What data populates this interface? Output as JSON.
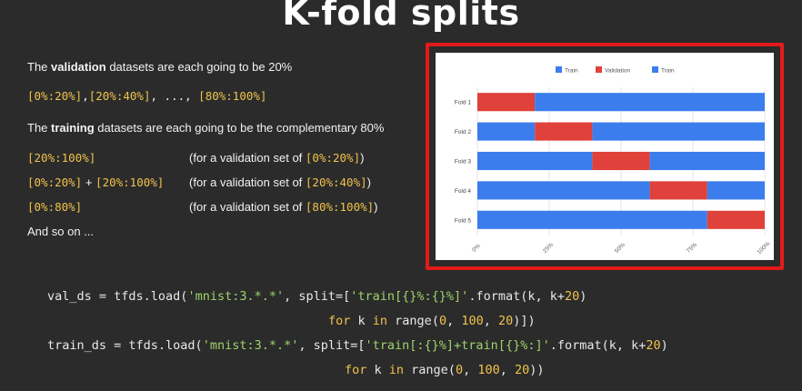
{
  "title": "K-fold splits",
  "text": {
    "val_intro_pre": "The ",
    "val_intro_bold": "validation",
    "val_intro_post": " datasets are each going to be 20%",
    "val_ranges": {
      "r1": "[0%:20%]",
      "r2": "[20%:40%]",
      "ellipsis": ", ..., ",
      "r3": "[80%:100%]",
      "sep": ","
    },
    "train_intro_pre": "The ",
    "train_intro_bold": "training",
    "train_intro_post": " datasets are each going to be the complementary 80%",
    "rows": [
      {
        "left": "[20%:100%]",
        "note_pre": "(for a validation set of ",
        "note_val": "[0%:20%]",
        "note_post": ")"
      },
      {
        "left_a": "[0%:20%]",
        "plus": " + ",
        "left_b": "[20%:100%]",
        "note_pre": "(for a validation set of ",
        "note_val": "[20%:40%]",
        "note_post": ")"
      },
      {
        "left": "[0%:80%]",
        "note_pre": "(for a validation set of ",
        "note_val": "[80%:100%]",
        "note_post": ")"
      }
    ],
    "and_so_on": "And so on ..."
  },
  "chart_data": {
    "type": "bar",
    "orientation": "horizontal",
    "stacked": true,
    "categories": [
      "Fold 1",
      "Fold 2",
      "Fold 3",
      "Fold 4",
      "Fold 5"
    ],
    "series": [
      {
        "name": "Train",
        "values": [
          0,
          20,
          40,
          60,
          80
        ]
      },
      {
        "name": "Validation",
        "values": [
          20,
          20,
          20,
          20,
          20
        ]
      },
      {
        "name": "Train",
        "values": [
          80,
          60,
          40,
          20,
          0
        ]
      }
    ],
    "xlim": [
      0,
      100
    ],
    "xticks": [
      "0%",
      "25%",
      "50%",
      "75%",
      "100%"
    ],
    "legend": "top",
    "colors": {
      "train": "#3b7ded",
      "validation": "#e0413a"
    },
    "grid": true
  },
  "code": {
    "l1_a": "val_ds = tfds.load(",
    "l1_s1": "'mnist:3.*.*'",
    "l1_b": ", split=[",
    "l1_s2": "'train[{}%:{}%]'",
    "l1_c": ".format(k, k+",
    "l1_n": "20",
    "l1_d": ")",
    "l2_kw1": "for",
    "l2_a": " k ",
    "l2_kw2": "in",
    "l2_b": " range(",
    "l2_n1": "0",
    "l2_c": ", ",
    "l2_n2": "100",
    "l2_d": ", ",
    "l2_n3": "20",
    "l2_e": ")])",
    "l3_a": "train_ds = tfds.load(",
    "l3_s1": "'mnist:3.*.*'",
    "l3_b": ", split=[",
    "l3_s2": "'train[:{}%]+train[{}%:]'",
    "l3_c": ".format(k, k+",
    "l3_n": "20",
    "l3_d": ")",
    "l4_kw1": "for",
    "l4_a": " k ",
    "l4_kw2": "in",
    "l4_b": " range(",
    "l4_n1": "0",
    "l4_c": ", ",
    "l4_n2": "100",
    "l4_d": ", ",
    "l4_n3": "20",
    "l4_e": "))"
  }
}
